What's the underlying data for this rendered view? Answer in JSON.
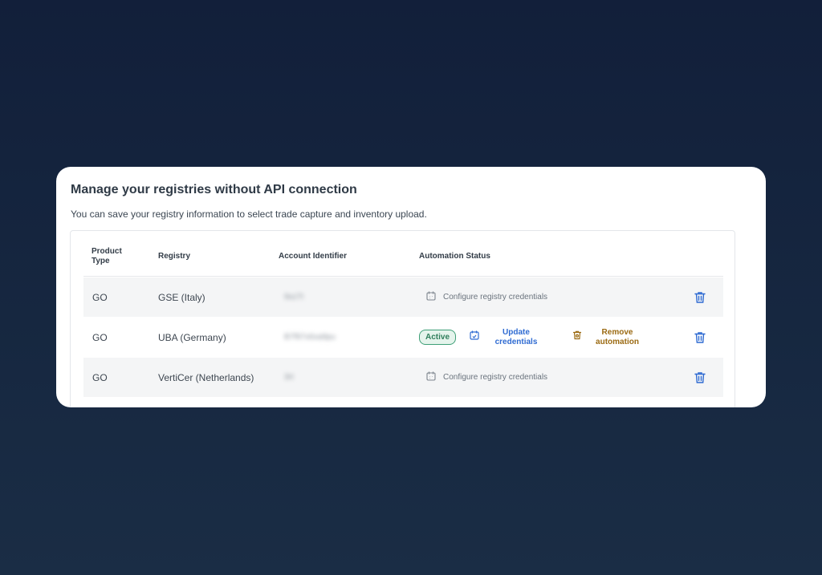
{
  "card": {
    "title": "Manage your registries without API connection",
    "subtitle": "You can save your registry information to select trade capture and inventory upload."
  },
  "table": {
    "headers": {
      "product_type": "Product Type",
      "registry": "Registry",
      "account_identifier": "Account Identifier",
      "automation_status": "Automation Status"
    },
    "rows": [
      {
        "product_type": "GO",
        "registry": "GSE (Italy)",
        "account_identifier": "9xz7t",
        "automation": {
          "action": "Configure registry credentials"
        }
      },
      {
        "product_type": "GO",
        "registry": "UBA (Germany)",
        "account_identifier": "B7f97x6xa9pu",
        "automation": {
          "status": "Active",
          "update_label": "Update credentials",
          "remove_label": "Remove automation"
        }
      },
      {
        "product_type": "GO",
        "registry": "VertiCer (Netherlands)",
        "account_identifier": "3rt",
        "automation": {
          "action": "Configure registry credentials"
        }
      }
    ]
  },
  "colors": {
    "background": "#142440",
    "card": "#ffffff",
    "link_blue": "#2f6bd2",
    "status_green": "#3e9f77",
    "remove_amber": "#9b6a12",
    "row_shade": "#f4f5f6"
  },
  "icons": {
    "calendar": "calendar-icon",
    "calendar_edit": "calendar-edit-icon",
    "remove_automation": "trash-small-icon",
    "delete_row": "trash-icon"
  }
}
